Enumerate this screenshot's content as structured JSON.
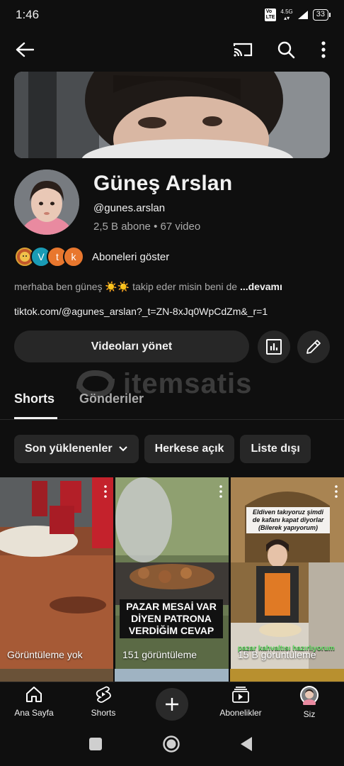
{
  "status_bar": {
    "time": "1:46",
    "network": "4.5G",
    "volte": "VoLTE",
    "battery": "33"
  },
  "channel": {
    "name": "Güneş Arslan",
    "handle": "@gunes.arslan",
    "stats": "2,5 B abone • 67 video",
    "subscribers_label": "Aboneleri göster",
    "subscriber_avatars": [
      {
        "letter": "",
        "color": "#d9a233"
      },
      {
        "letter": "V",
        "color": "#1a9bb5"
      },
      {
        "letter": "t",
        "color": "#e8772e"
      },
      {
        "letter": "k",
        "color": "#e8772e"
      }
    ],
    "description": "merhaba ben güneş ☀️☀️ takip eder misin beni de ",
    "description_more": "...devamı",
    "link": "tiktok.com/@agunes_arslan?_t=ZN-8xJq0WpCdZm&_r=1"
  },
  "actions": {
    "manage_videos": "Videoları yönet"
  },
  "watermark": "itemsatis",
  "tabs": [
    {
      "label": "Shorts",
      "active": true
    },
    {
      "label": "Gönderiler",
      "active": false
    }
  ],
  "chips": [
    {
      "label": "Son yüklenenler",
      "has_dropdown": true
    },
    {
      "label": "Herkese açık"
    },
    {
      "label": "Liste dışı"
    }
  ],
  "shorts": [
    {
      "views": "Görüntüleme yok",
      "caption": ""
    },
    {
      "views": "151 görüntüleme",
      "caption": "PAZAR MESAİ VAR DİYEN PATRONA VERDİĞİM CEVAP"
    },
    {
      "views": "15 B görüntüleme",
      "caption": "Eldiven takıyoruz şimdi de kafanı kapat diyorlar (Bilerek yapıyorum)",
      "overlay_text": "pazar kahvaltısı hazırlıyorum"
    }
  ],
  "bottom_nav": [
    {
      "label": "Ana Sayfa",
      "icon": "home-icon"
    },
    {
      "label": "Shorts",
      "icon": "shorts-icon"
    },
    {
      "label": "",
      "icon": "create-icon"
    },
    {
      "label": "Abonelikler",
      "icon": "subscriptions-icon"
    },
    {
      "label": "Siz",
      "icon": "you-avatar"
    }
  ]
}
